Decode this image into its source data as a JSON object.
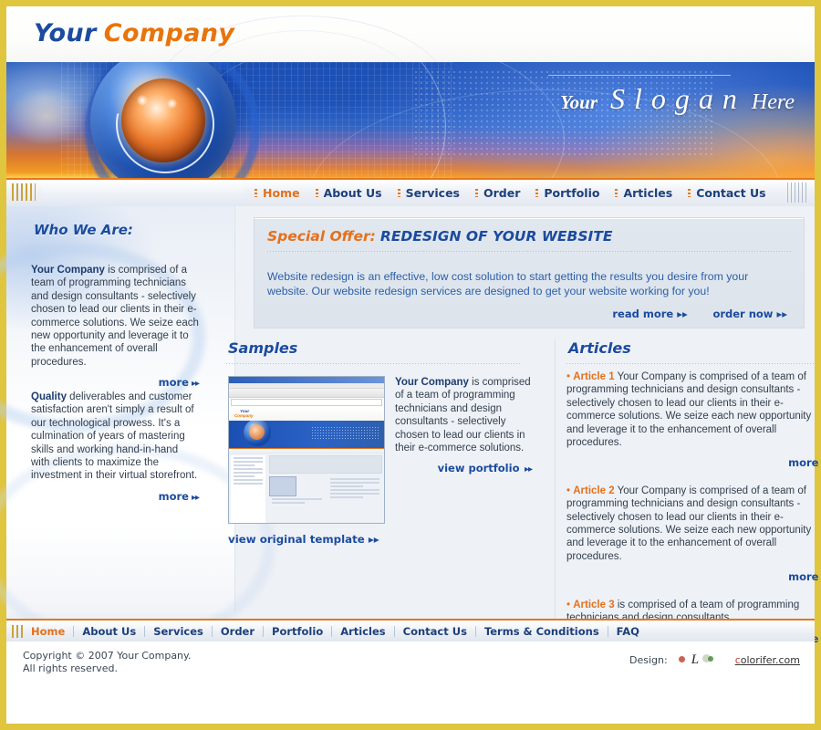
{
  "logo": {
    "word1": "Your",
    "word2": "Company"
  },
  "banner": {
    "slogan_your": "Your",
    "slogan_main": "Slogan",
    "slogan_here": "Here"
  },
  "main_nav": {
    "items": [
      {
        "label": "Home",
        "active": true
      },
      {
        "label": "About Us",
        "active": false
      },
      {
        "label": "Services",
        "active": false
      },
      {
        "label": "Order",
        "active": false
      },
      {
        "label": "Portfolio",
        "active": false
      },
      {
        "label": "Articles",
        "active": false
      },
      {
        "label": "Contact Us",
        "active": false
      }
    ]
  },
  "sidebar": {
    "heading": "Who We Are:",
    "block1_lead": "Your Company",
    "block1_text": " is comprised of a team of programming technicians and design consultants - selectively chosen to lead our clients in their e-commerce solutions. We seize each new opportunity and leverage it to the enhancement of overall procedures.",
    "block1_more": "more",
    "block2_lead": "Quality",
    "block2_text": " deliverables and customer satisfaction aren't simply a result of our technological prowess. It's a culmination of years of mastering skills and working hand-in-hand with clients to maximize the investment in their virtual storefront.",
    "block2_more": "more"
  },
  "offer": {
    "label": "Special Offer:",
    "title": "REDESIGN OF YOUR WEBSITE",
    "text": "Website redesign is an effective, low cost solution to start getting the results you desire from your website. Our website redesign services are designed to get your website working for you!",
    "read_more": "read more",
    "order_now": "order now"
  },
  "samples": {
    "heading": "Samples",
    "thumb_logo_word1": "Your",
    "thumb_logo_word2": "Company",
    "text_lead": "Your Company",
    "text_body": " is comprised of a team of programming technicians and design consultants - selectively chosen to lead our clients in their e-commerce solutions.",
    "view_portfolio": "view portfolio",
    "view_original": "view original template"
  },
  "articles": {
    "heading": "Articles",
    "items": [
      {
        "lead": "Article 1",
        "text": " Your Company is comprised of a team of programming technicians and design consultants - selectively chosen to lead our clients in their e-commerce solutions. We seize each new opportunity and leverage it to the enhancement of overall procedures.",
        "more": "more"
      },
      {
        "lead": "Article 2",
        "text": " Your Company is comprised of a team of programming technicians and design consultants - selectively chosen to lead our clients in their e-commerce solutions. We seize each new opportunity and leverage it to the enhancement of overall procedures.",
        "more": "more"
      },
      {
        "lead": "Article 3",
        "text": " is comprised of a team of programming technicians and design consultants.",
        "more": "more"
      }
    ]
  },
  "footer_nav": {
    "items": [
      {
        "label": "Home",
        "active": true
      },
      {
        "label": "About Us",
        "active": false
      },
      {
        "label": "Services",
        "active": false
      },
      {
        "label": "Order",
        "active": false
      },
      {
        "label": "Portfolio",
        "active": false
      },
      {
        "label": "Articles",
        "active": false
      },
      {
        "label": "Contact Us",
        "active": false
      },
      {
        "label": "Terms & Conditions",
        "active": false
      },
      {
        "label": "FAQ",
        "active": false
      }
    ]
  },
  "footer": {
    "copyright_line1": "Copyright © 2007 Your Company.",
    "copyright_line2": "All rights reserved.",
    "design_label": "Design:",
    "design_site_c": "c",
    "design_site_rest": "olorifer.com"
  },
  "colors": {
    "border_gold": "#e0c53f",
    "blue": "#1b4b9e",
    "orange": "#e4701b",
    "body_bg": "#eef1f6",
    "offer_bg": "#dde4ec",
    "text": "#33404f"
  }
}
